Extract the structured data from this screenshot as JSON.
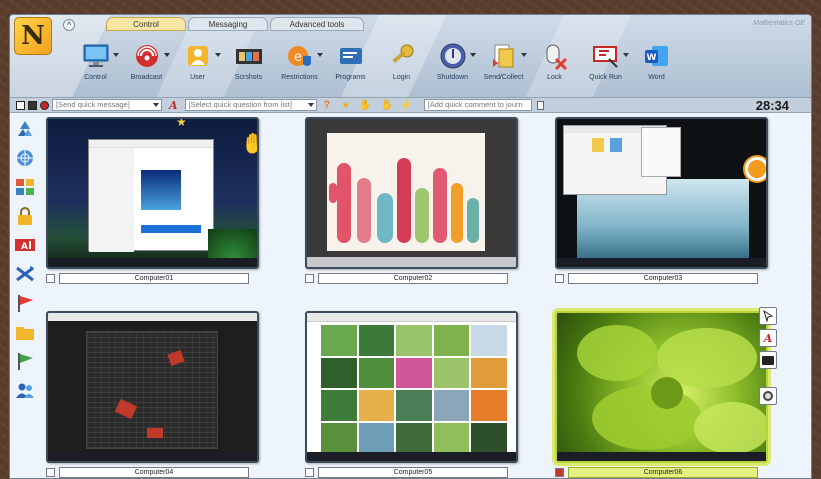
{
  "tabs": [
    {
      "label": "Control",
      "active": true
    },
    {
      "label": "Messaging",
      "active": false
    },
    {
      "label": "Advanced tools",
      "active": false
    }
  ],
  "brand_tag": "Mathematics GE",
  "toolbar": [
    {
      "label": "Control",
      "icon": "monitor-icon"
    },
    {
      "label": "Broadcast",
      "icon": "broadcast-icon"
    },
    {
      "label": "User",
      "icon": "user-icon"
    },
    {
      "label": "Scrshots",
      "icon": "filmstrip-icon"
    },
    {
      "label": "Restrictions",
      "icon": "restrictions-icon"
    },
    {
      "label": "Programs",
      "icon": "programs-icon"
    },
    {
      "label": "Login",
      "icon": "key-icon"
    },
    {
      "label": "Shutdown",
      "icon": "power-icon"
    },
    {
      "label": "Send/Collect",
      "icon": "send-collect-icon"
    },
    {
      "label": "Lock",
      "icon": "mouse-lock-icon"
    },
    {
      "label": "Quick Run",
      "icon": "quick-run-icon"
    },
    {
      "label": "Word",
      "icon": "word-icon"
    }
  ],
  "quickbar": {
    "message_placeholder": "[Send quick message]",
    "question_placeholder": "[Select quick question from list]",
    "comment_placeholder": "[Add quick comment to journ",
    "clock": "28:34"
  },
  "sidebar_icons": [
    "recycle-icon",
    "globe-icon",
    "grid-icon",
    "lock-icon",
    "text-icon",
    "shuffle-icon",
    "red-flag-icon",
    "folder-icon",
    "green-flag-icon",
    "users-icon"
  ],
  "computers": [
    {
      "name": "Computer01",
      "selected": false
    },
    {
      "name": "Computer02",
      "selected": false
    },
    {
      "name": "Computer03",
      "selected": false
    },
    {
      "name": "Computer04",
      "selected": false
    },
    {
      "name": "Computer05",
      "selected": false
    },
    {
      "name": "Computer06",
      "selected": true
    }
  ],
  "colors": {
    "accent": "#f8e6a6",
    "selection": "#dbe96f",
    "brand": "#f0a21c"
  }
}
